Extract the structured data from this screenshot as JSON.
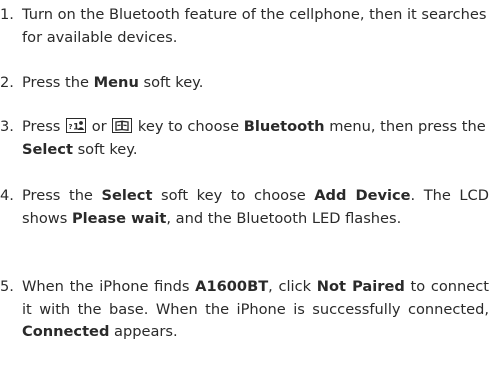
{
  "steps": [
    {
      "number": "1.",
      "text": "Turn on the Bluetooth feature of the cellphone, then it searches for available devices."
    },
    {
      "number": "2.",
      "pre": "Press the ",
      "b1": "Menu",
      "post": " soft key."
    },
    {
      "number": "3.",
      "pre": "Press ",
      "key1_icon": "phonebook-key-icon",
      "mid": " or ",
      "key2_icon": "book-key-icon",
      "mid2": " key to choose ",
      "b1": "Bluetooth",
      "mid3": " menu, then press the ",
      "b2": "Select",
      "post": " soft key."
    },
    {
      "number": "4.",
      "pre": "Press the ",
      "b1": "Select",
      "mid": " soft key to choose ",
      "b2": "Add Device",
      "mid2": ". The LCD shows ",
      "b3": "Please wait",
      "post": ", and the Bluetooth LED flashes."
    },
    {
      "number": "5.",
      "pre": "When the iPhone finds ",
      "b1": "A1600BT",
      "mid": ", click ",
      "b2": "Not Paired",
      "mid2": " to connect it with the base. When the iPhone is successfully connected, ",
      "b3": "Connected",
      "post": " appears."
    }
  ]
}
